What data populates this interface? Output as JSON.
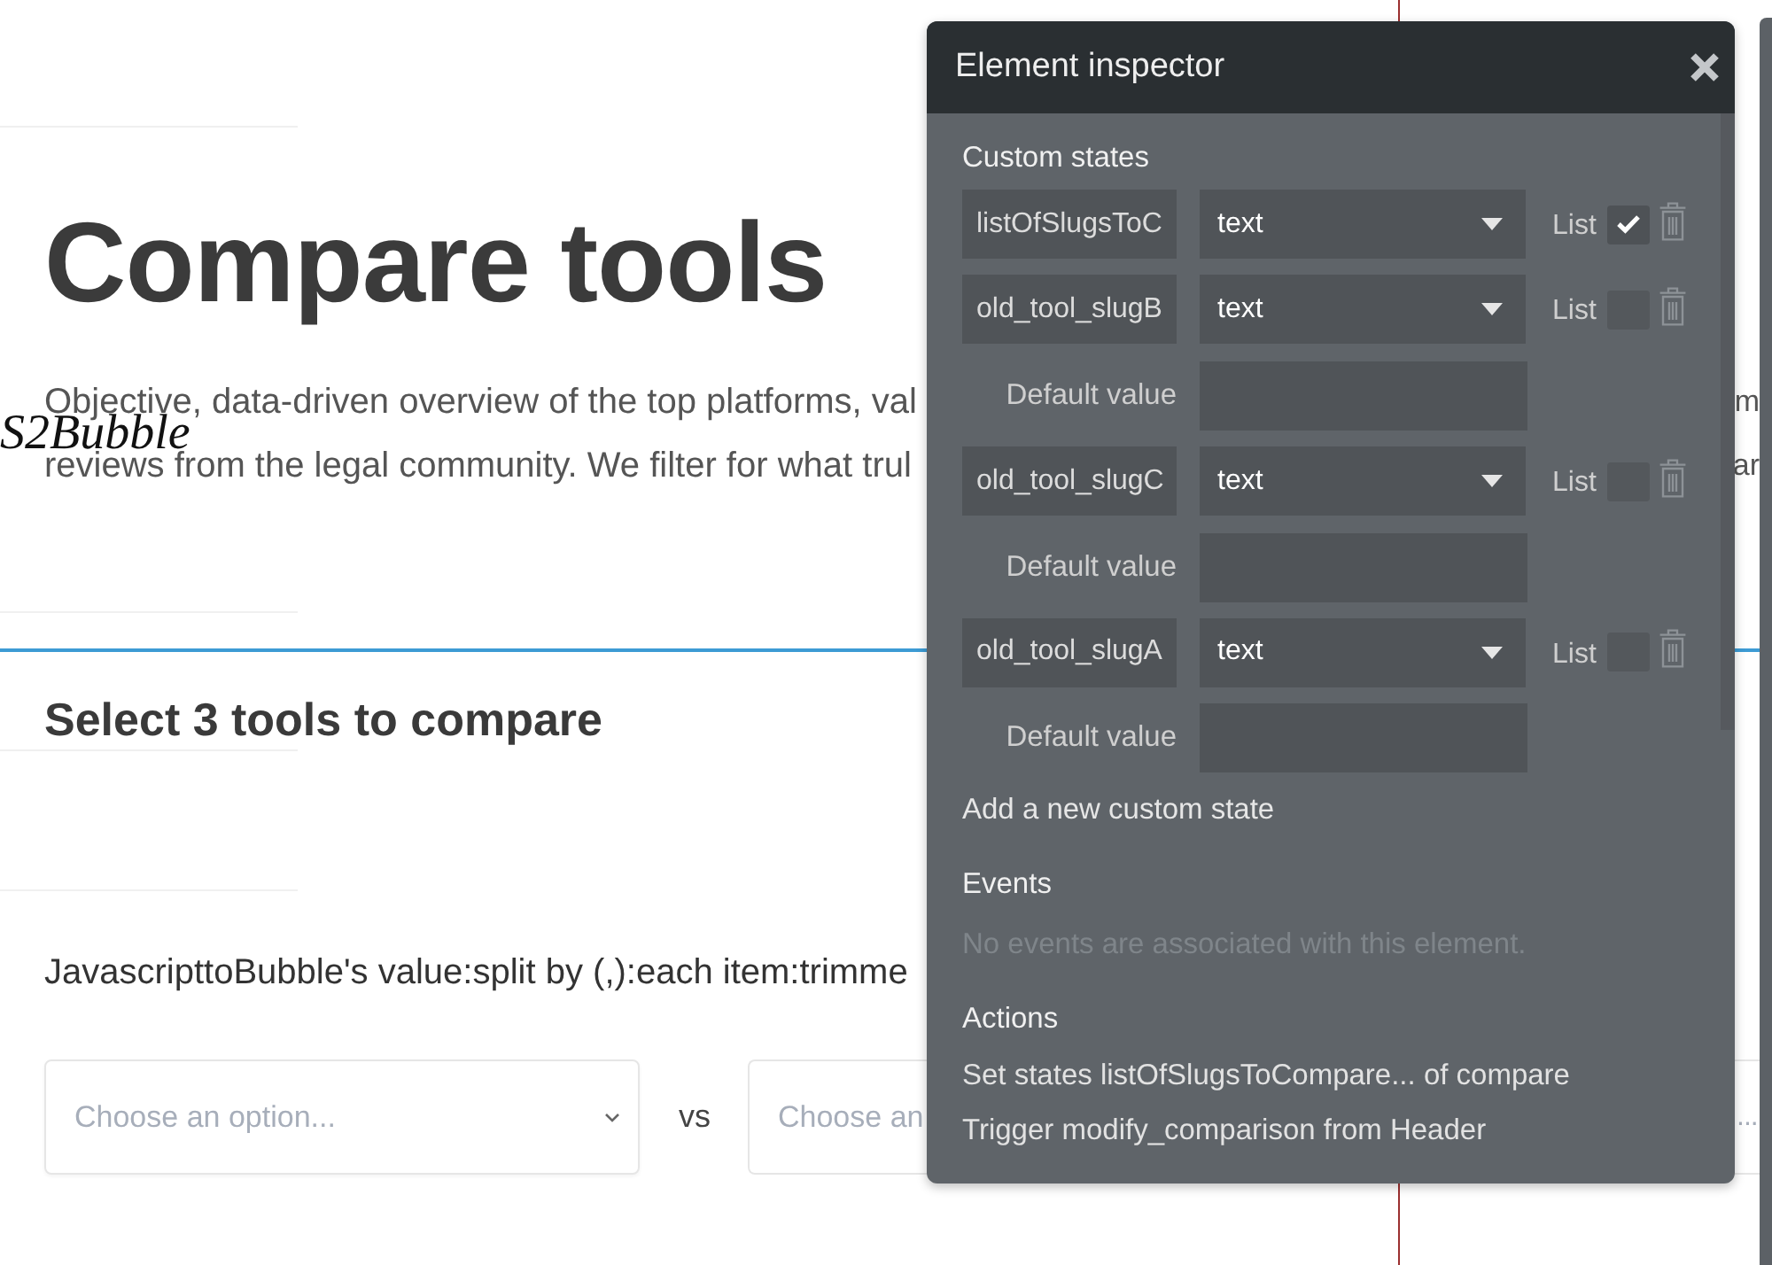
{
  "page": {
    "title": "Compare tools",
    "intro_lines": [
      {
        "text": "Objective, data-driven overview of the top platforms, val",
        "tail": "m"
      },
      {
        "text": "reviews from the legal community. We filter for what trul",
        "tail": "ar"
      }
    ],
    "overlay_label": "S2Bubble",
    "section_title": "Select 3 tools to compare",
    "expression": "JavascripttoBubble's value:split by (,):each item:trimme",
    "dropdowns": [
      {
        "kind": "full",
        "placeholder": "Choose an option..."
      },
      {
        "kind": "left_part",
        "placeholder": "Choose an"
      },
      {
        "kind": "right_part",
        "placeholder": "..."
      }
    ],
    "separator": "vs"
  },
  "inspector": {
    "title": "Element inspector",
    "custom_states_heading": "Custom states",
    "custom_states": [
      {
        "name": "listOfSlugsToC",
        "type": "text",
        "list_label": "List",
        "list_checked": true
      },
      {
        "name": "old_tool_slugB",
        "type": "text",
        "list_label": "List",
        "list_checked": false,
        "default_label": "Default value"
      },
      {
        "name": "old_tool_slugC",
        "type": "text",
        "list_label": "List",
        "list_checked": false,
        "default_label": "Default value"
      },
      {
        "name": "old_tool_slugA",
        "type": "text",
        "list_label": "List",
        "list_checked": false,
        "default_label": "Default value"
      }
    ],
    "add_state": "Add a new custom state",
    "events_heading": "Events",
    "events_empty": "No events are associated with this element.",
    "actions_heading": "Actions",
    "actions": [
      "Set states listOfSlugsToCompare... of compare",
      "Trigger modify_comparison from Header"
    ]
  }
}
